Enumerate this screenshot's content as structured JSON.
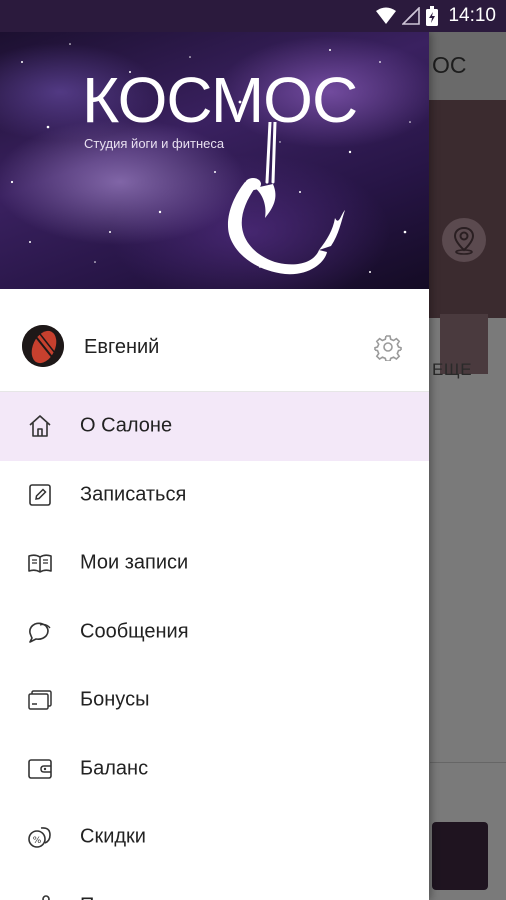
{
  "status_bar": {
    "time": "14:10"
  },
  "background_app": {
    "title_fragment": "ОС",
    "more_label": "ЕЩЕ"
  },
  "drawer": {
    "logo": {
      "title": "КОСМОС",
      "subtitle": "Студия йоги и фитнеса"
    },
    "user": {
      "name": "Евгений"
    },
    "menu": [
      {
        "label": "О Салоне",
        "icon": "home-icon",
        "active": true
      },
      {
        "label": "Записаться",
        "icon": "edit-icon",
        "active": false
      },
      {
        "label": "Мои записи",
        "icon": "book-icon",
        "active": false
      },
      {
        "label": "Сообщения",
        "icon": "chat-icon",
        "active": false
      },
      {
        "label": "Бонусы",
        "icon": "card-icon",
        "active": false
      },
      {
        "label": "Баланс",
        "icon": "wallet-icon",
        "active": false
      },
      {
        "label": "Скидки",
        "icon": "discount-icon",
        "active": false
      },
      {
        "label": "П",
        "icon": "share-icon",
        "active": false
      }
    ]
  },
  "colors": {
    "accent_bg": "#f3e8f8",
    "status_bar": "#2b1a3d"
  }
}
